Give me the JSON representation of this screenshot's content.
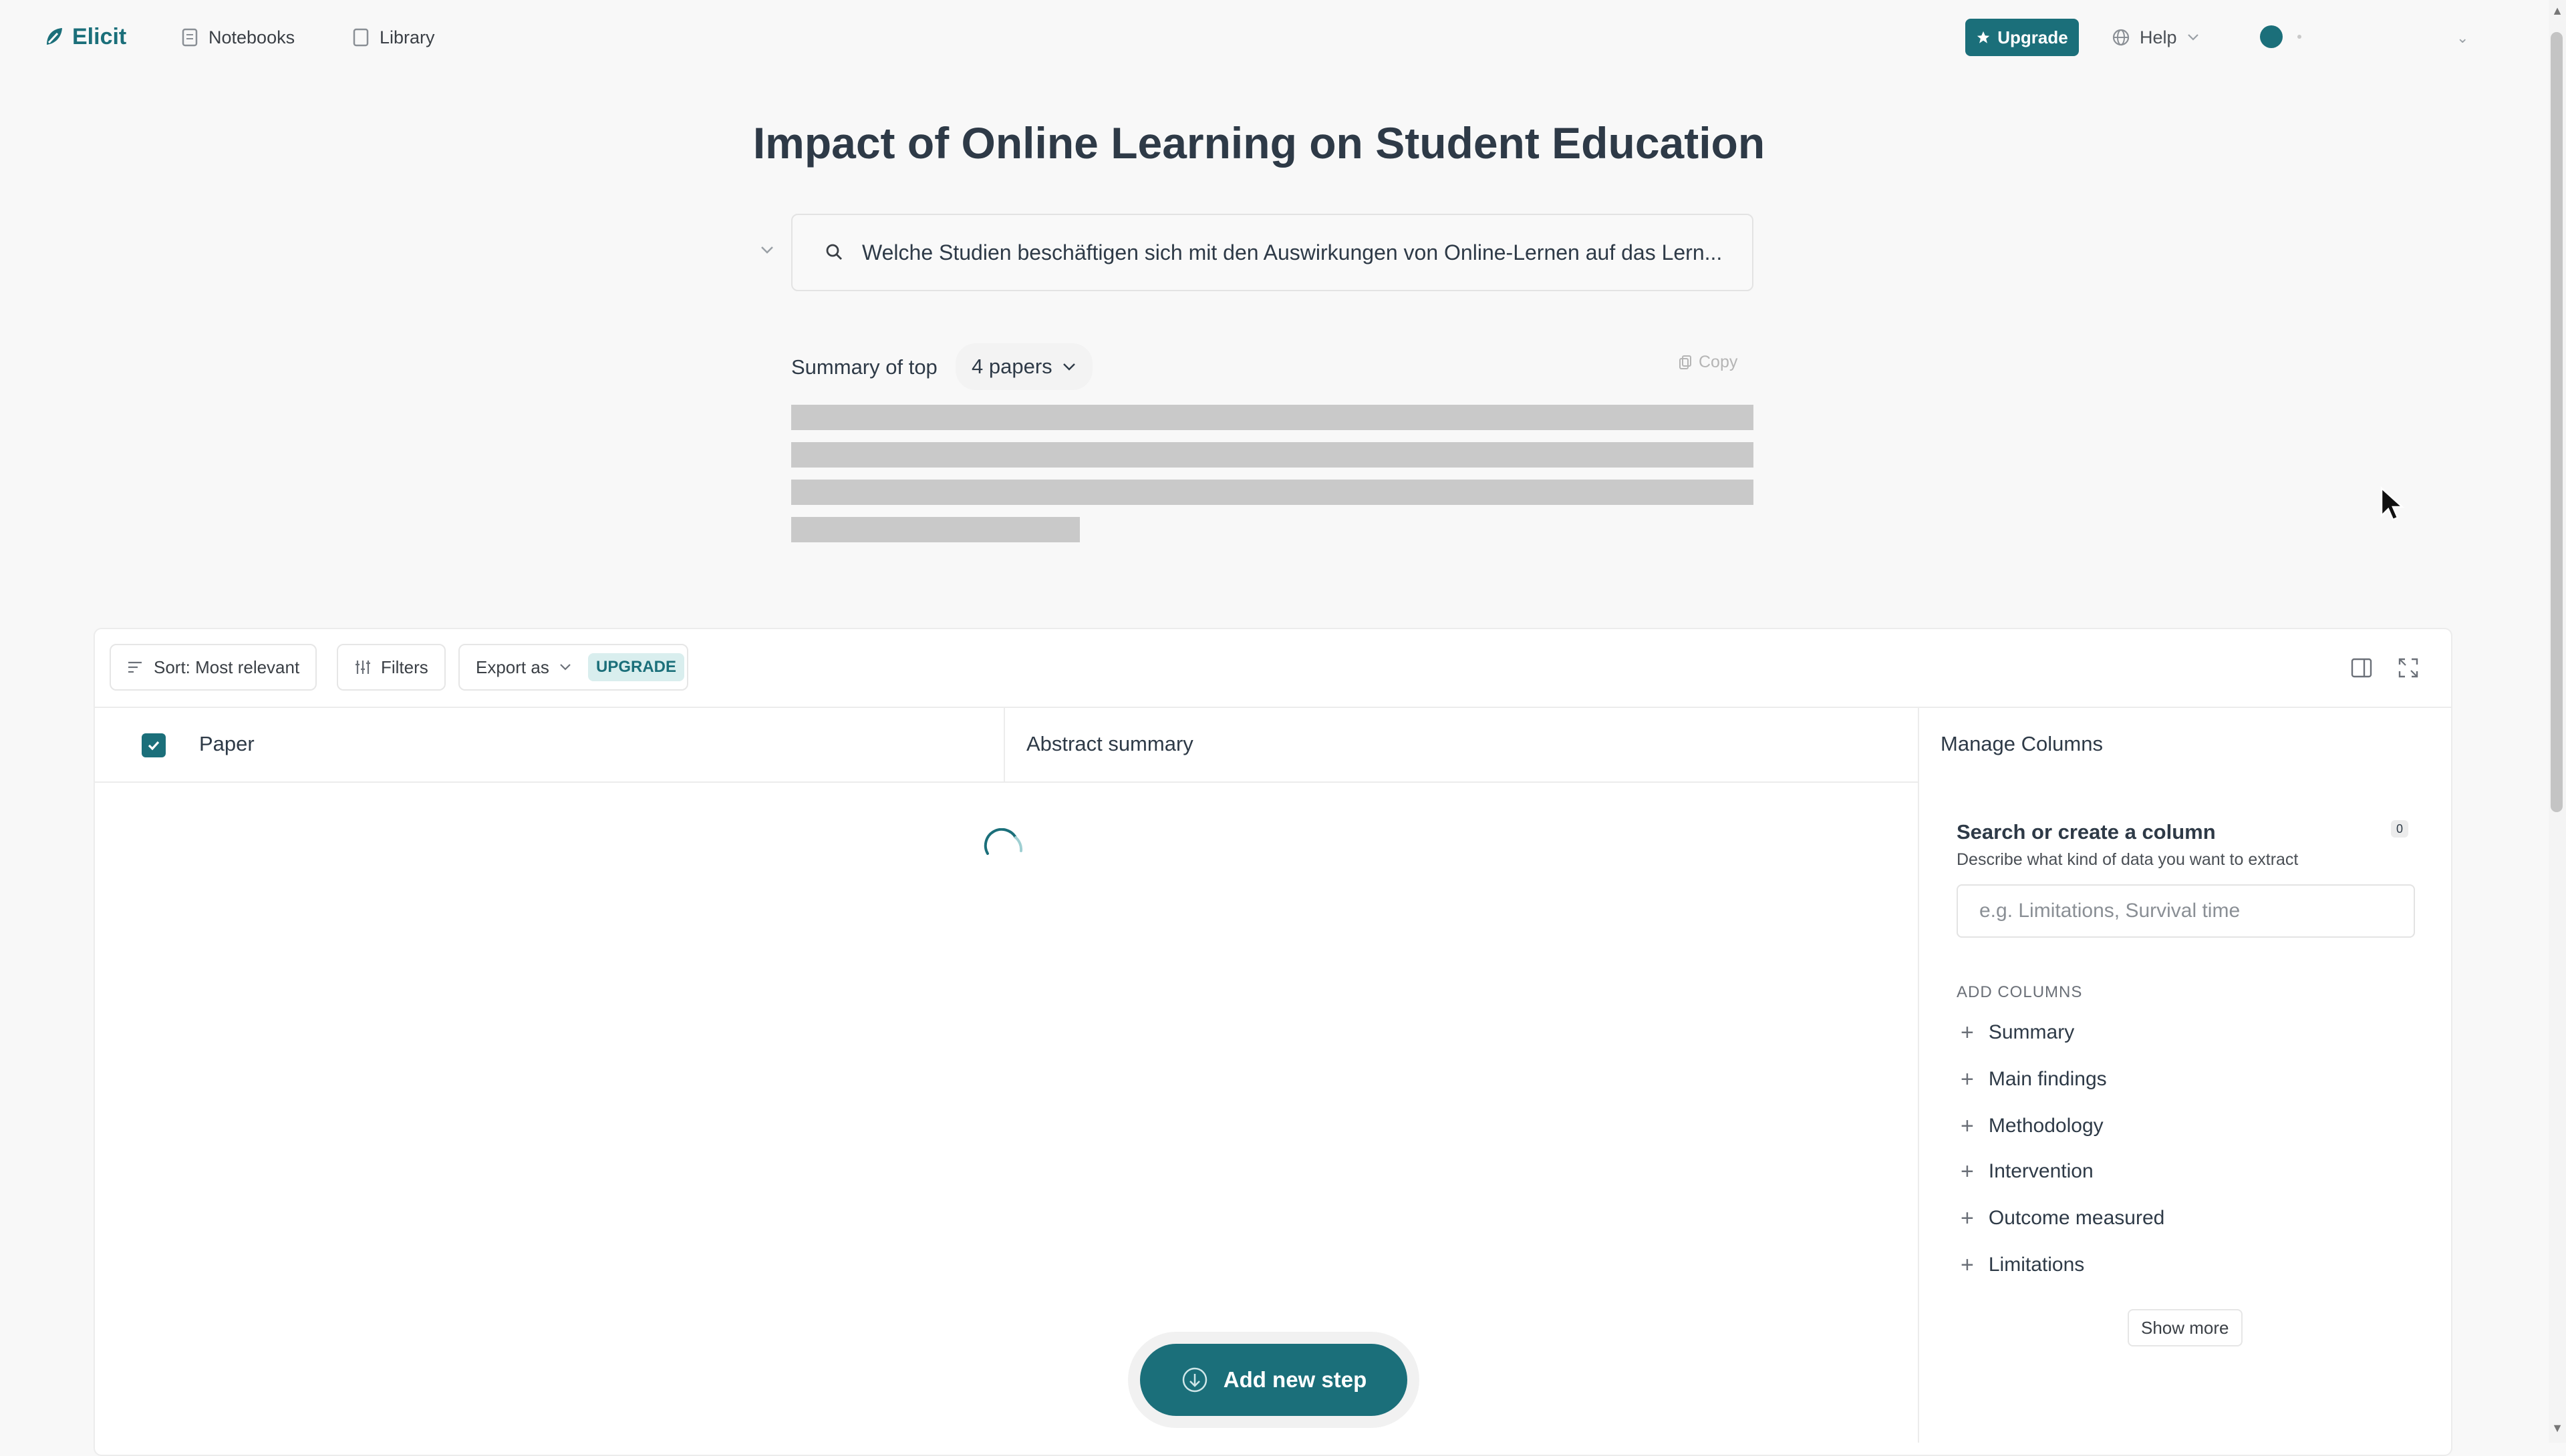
{
  "app": {
    "name": "Elicit"
  },
  "nav": {
    "notebooks": "Notebooks",
    "library": "Library",
    "upgrade": "Upgrade",
    "help": "Help"
  },
  "page": {
    "title": "Impact of Online Learning on Student Education",
    "query": "Welche Studien beschäftigen sich mit den Auswirkungen von Online-Lernen auf das Lern..."
  },
  "summary": {
    "label": "Summary of top",
    "papers": "4 papers",
    "copy": "Copy"
  },
  "toolbar": {
    "sort": "Sort: Most relevant",
    "filters": "Filters",
    "export": "Export as",
    "upgrade_tag": "UPGRADE"
  },
  "table": {
    "col_paper": "Paper",
    "col_abstract": "Abstract summary",
    "col_manage": "Manage Columns"
  },
  "manage": {
    "title": "Search or create a column",
    "desc": "Describe what kind of data you want to extract",
    "badge": "0",
    "placeholder": "e.g. Limitations, Survival time",
    "add_label": "ADD COLUMNS",
    "items": [
      "Summary",
      "Main findings",
      "Methodology",
      "Intervention",
      "Outcome measured",
      "Limitations"
    ],
    "show_more": "Show more"
  },
  "add_step": "Add new step",
  "colors": {
    "accent": "#1b6f7a",
    "skeleton": "#c9c9c9",
    "tag_bg": "#d9eeee"
  }
}
